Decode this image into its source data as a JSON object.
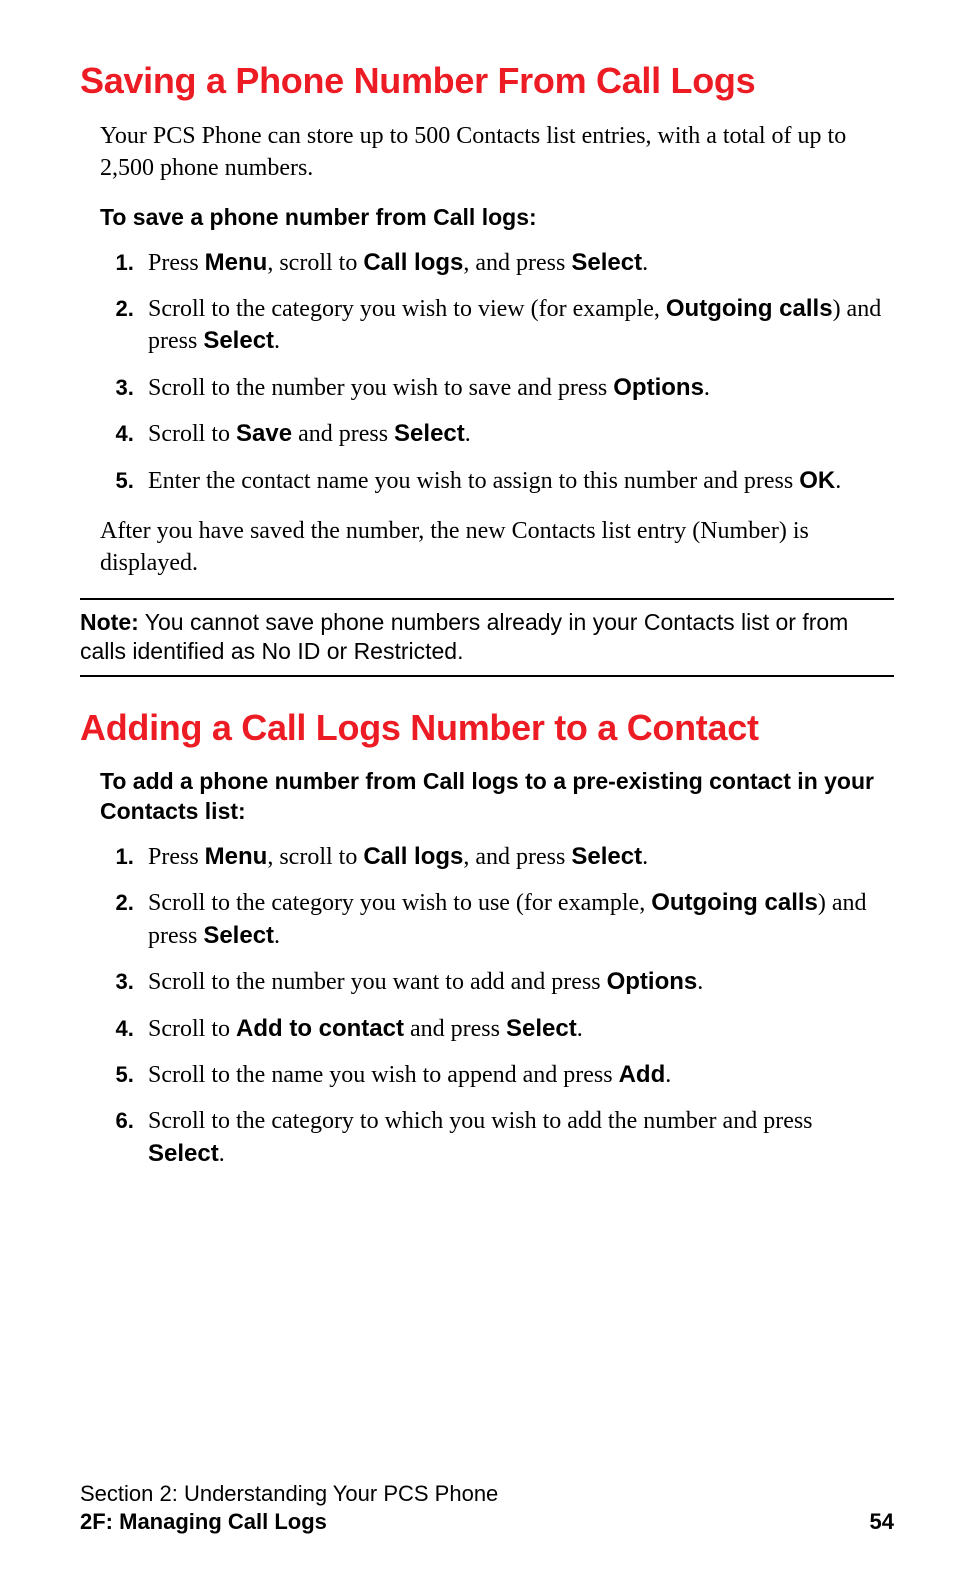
{
  "section1": {
    "heading": "Saving a Phone Number From Call Logs",
    "intro": "Your PCS Phone can store up to 500 Contacts list entries, with a total of up to 2,500 phone numbers.",
    "leadin": "To save a phone number from Call logs:",
    "steps": [
      {
        "pre": "Press ",
        "b1": "Menu",
        "mid1": ", scroll to ",
        "b2": "Call logs",
        "mid2": ", and press ",
        "b3": "Select",
        "post": "."
      },
      {
        "pre": "Scroll to the category you wish to view (for example, ",
        "b1": "Outgoing calls",
        "mid1": ") and press ",
        "b2": "Select",
        "post": "."
      },
      {
        "pre": "Scroll to the number you wish to save and press ",
        "b1": "Options",
        "post": "."
      },
      {
        "pre": "Scroll to ",
        "b1": "Save",
        "mid1": " and press ",
        "b2": "Select",
        "post": "."
      },
      {
        "pre": "Enter the contact name you wish to assign to this number and press ",
        "b1": "OK",
        "post": "."
      }
    ],
    "after": "After you have saved the number, the new Contacts list entry (Number) is displayed."
  },
  "note": {
    "label": "Note:",
    "text": " You cannot save phone numbers already in your Contacts list or from calls identified as No ID or Restricted."
  },
  "section2": {
    "heading": "Adding a Call Logs Number to a Contact",
    "leadin": "To add a phone number from Call logs to a pre-existing contact in your Contacts list:",
    "steps": [
      {
        "pre": "Press ",
        "b1": "Menu",
        "mid1": ", scroll to ",
        "b2": "Call logs",
        "mid2": ", and press ",
        "b3": "Select",
        "post": "."
      },
      {
        "pre": "Scroll to the category you wish to use (for example, ",
        "b1": "Outgoing calls",
        "mid1": ") and press ",
        "b2": "Select",
        "post": "."
      },
      {
        "pre": "Scroll to the number you want to add and press ",
        "b1": "Options",
        "post": "."
      },
      {
        "pre": "Scroll to ",
        "b1": "Add to contact",
        "mid1": " and press ",
        "b2": "Select",
        "post": "."
      },
      {
        "pre": "Scroll to the name you wish to append and press ",
        "b1": "Add",
        "post": "."
      },
      {
        "pre": "Scroll to the category to which you wish to add the number and press ",
        "b1": "Select",
        "post": "."
      }
    ]
  },
  "footer": {
    "line1": "Section 2: Understanding Your PCS Phone",
    "line2": "2F: Managing Call Logs",
    "page": "54"
  }
}
